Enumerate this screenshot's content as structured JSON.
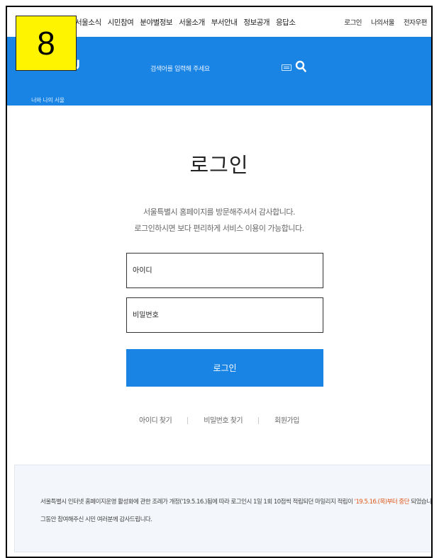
{
  "badge": {
    "number": "8"
  },
  "nav": {
    "menu": [
      "서울소식",
      "시민참여",
      "분야별정보",
      "서울소개",
      "부서안내",
      "정보공개",
      "응답소"
    ],
    "util": [
      "로그인",
      "나의서울",
      "전자우편"
    ]
  },
  "header": {
    "logo_letter": "U",
    "logo_sub": "너와 나의 서울",
    "search_placeholder": "검색어를 입력해 주세요",
    "colors": {
      "brand": "#1a84e5",
      "badge": "#fff400",
      "highlight": "#e0561a"
    }
  },
  "login": {
    "title": "로그인",
    "desc1": "서울특별시 홈페이지를 방문해주셔서 감사합니다.",
    "desc2": "로그인하시면 보다 편리하게 서비스 이용이 가능합니다.",
    "id_placeholder": "아이디",
    "pw_placeholder": "비밀번호",
    "button_label": "로그인",
    "links": {
      "find_id": "아이디 찾기",
      "find_pw": "비밀번호 찾기",
      "join": "회원가입"
    }
  },
  "notice": {
    "line1_before": "서울특별시 인터넷 홈페이지운영 활성화에 관한 조례가 개정('19.5.16.)됨에 따라 로그인시 1일 1회 10점씩 적립되던 마일리지 적립이 ",
    "line1_highlight": "'19.5.16.(목)부터 중단",
    "line1_after": " 되었습니다.",
    "line2": "그동안 참여해주신 시민 여러분께 감사드립니다."
  }
}
